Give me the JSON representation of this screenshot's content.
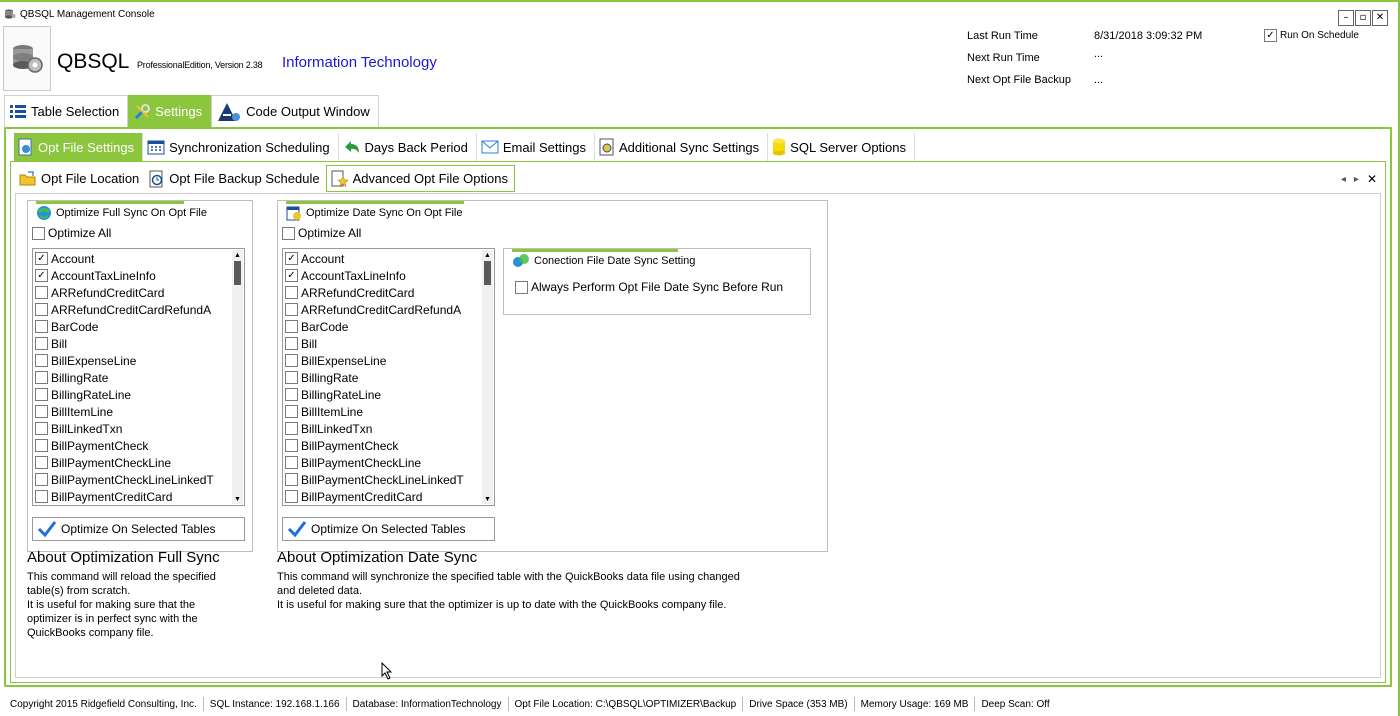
{
  "window": {
    "title": "QBSQL Management Console",
    "buttons": [
      "–",
      "▫",
      "✕"
    ]
  },
  "header": {
    "app_name": "QBSQL",
    "edition": "ProfessionalEdition, Version 2.38",
    "company": "Information Technology",
    "last_run_label": "Last Run Time",
    "last_run_value": "8/31/2018 3:09:32 PM",
    "next_run_label": "Next Run Time",
    "next_run_value": "...",
    "next_backup_label": "Next Opt File Backup",
    "next_backup_value": "...",
    "run_on_schedule_label": "Run On Schedule",
    "run_on_schedule_checked": true
  },
  "main_tabs": [
    {
      "label": "Table Selection",
      "icon": "table-list-icon",
      "active": false
    },
    {
      "label": "Settings",
      "icon": "tools-icon",
      "active": true
    },
    {
      "label": "Code Output Window",
      "icon": "code-output-icon",
      "active": false
    }
  ],
  "settings_tabs": [
    {
      "label": "Opt File Settings",
      "icon": "opt-file-icon",
      "active": true
    },
    {
      "label": "Synchronization Scheduling",
      "icon": "calendar-icon",
      "active": false
    },
    {
      "label": "Days Back Period",
      "icon": "back-arrow-icon",
      "active": false
    },
    {
      "label": "Email Settings",
      "icon": "envelope-icon",
      "active": false
    },
    {
      "label": "Additional Sync Settings",
      "icon": "sync-settings-icon",
      "active": false
    },
    {
      "label": "SQL Server Options",
      "icon": "database-icon",
      "active": false
    }
  ],
  "opt_tabs": [
    {
      "label": "Opt File Location",
      "icon": "folder-icon",
      "active": false
    },
    {
      "label": "Opt File Backup Schedule",
      "icon": "backup-clock-icon",
      "active": false
    },
    {
      "label": "Advanced Opt File Options",
      "icon": "star-doc-icon",
      "active": true
    }
  ],
  "full_sync": {
    "title": "Optimize Full Sync On Opt File",
    "optimize_all_label": "Optimize All",
    "tables": [
      {
        "name": "Account",
        "checked": true
      },
      {
        "name": "AccountTaxLineInfo",
        "checked": true
      },
      {
        "name": "ARRefundCreditCard",
        "checked": false
      },
      {
        "name": "ARRefundCreditCardRefundA",
        "checked": false
      },
      {
        "name": "BarCode",
        "checked": false
      },
      {
        "name": "Bill",
        "checked": false
      },
      {
        "name": "BillExpenseLine",
        "checked": false
      },
      {
        "name": "BillingRate",
        "checked": false
      },
      {
        "name": "BillingRateLine",
        "checked": false
      },
      {
        "name": "BillItemLine",
        "checked": false
      },
      {
        "name": "BillLinkedTxn",
        "checked": false
      },
      {
        "name": "BillPaymentCheck",
        "checked": false
      },
      {
        "name": "BillPaymentCheckLine",
        "checked": false
      },
      {
        "name": "BillPaymentCheckLineLinkedT",
        "checked": false
      },
      {
        "name": "BillPaymentCreditCard",
        "checked": false
      }
    ],
    "button_label": "Optimize On Selected Tables",
    "about_title": "About Optimization Full Sync",
    "about_lines": [
      "This command will reload the specified",
      "table(s) from scratch.",
      "It is useful for making sure that the",
      "optimizer is in perfect sync with the",
      "QuickBooks company file."
    ]
  },
  "date_sync": {
    "title": "Optimize Date Sync On Opt File",
    "optimize_all_label": "Optimize All",
    "tables": [
      {
        "name": "Account",
        "checked": true
      },
      {
        "name": "AccountTaxLineInfo",
        "checked": true
      },
      {
        "name": "ARRefundCreditCard",
        "checked": false
      },
      {
        "name": "ARRefundCreditCardRefundA",
        "checked": false
      },
      {
        "name": "BarCode",
        "checked": false
      },
      {
        "name": "Bill",
        "checked": false
      },
      {
        "name": "BillExpenseLine",
        "checked": false
      },
      {
        "name": "BillingRate",
        "checked": false
      },
      {
        "name": "BillingRateLine",
        "checked": false
      },
      {
        "name": "BillItemLine",
        "checked": false
      },
      {
        "name": "BillLinkedTxn",
        "checked": false
      },
      {
        "name": "BillPaymentCheck",
        "checked": false
      },
      {
        "name": "BillPaymentCheckLine",
        "checked": false
      },
      {
        "name": "BillPaymentCheckLineLinkedT",
        "checked": false
      },
      {
        "name": "BillPaymentCreditCard",
        "checked": false
      }
    ],
    "button_label": "Optimize On Selected Tables",
    "about_title": "About Optimization Date Sync",
    "about_lines": [
      "This command will synchronize the specified table with the QuickBooks data file using changed",
      "and deleted data.",
      "It is useful for making sure that the optimizer is up to date with the QuickBooks company file."
    ]
  },
  "connection_setting": {
    "title": "Conection File Date Sync Setting",
    "checkbox_label": "Always Perform Opt File Date Sync Before Run",
    "checked": false
  },
  "status_bar": {
    "copyright": "Copyright 2015 Ridgefield Consulting, Inc.",
    "sql_instance": "SQL Instance: 192.168.1.166",
    "database": "Database: InformationTechnology",
    "opt_file_location": "Opt File Location: C:\\QBSQL\\OPTIMIZER\\Backup",
    "drive_space": "Drive Space (353 MB)",
    "memory_usage": "Memory Usage: 169 MB",
    "deep_scan": "Deep Scan: Off"
  },
  "colors": {
    "accent": "#8cc63f",
    "company_text": "#1a1ad6",
    "check_blue": "#1e6fd9"
  }
}
